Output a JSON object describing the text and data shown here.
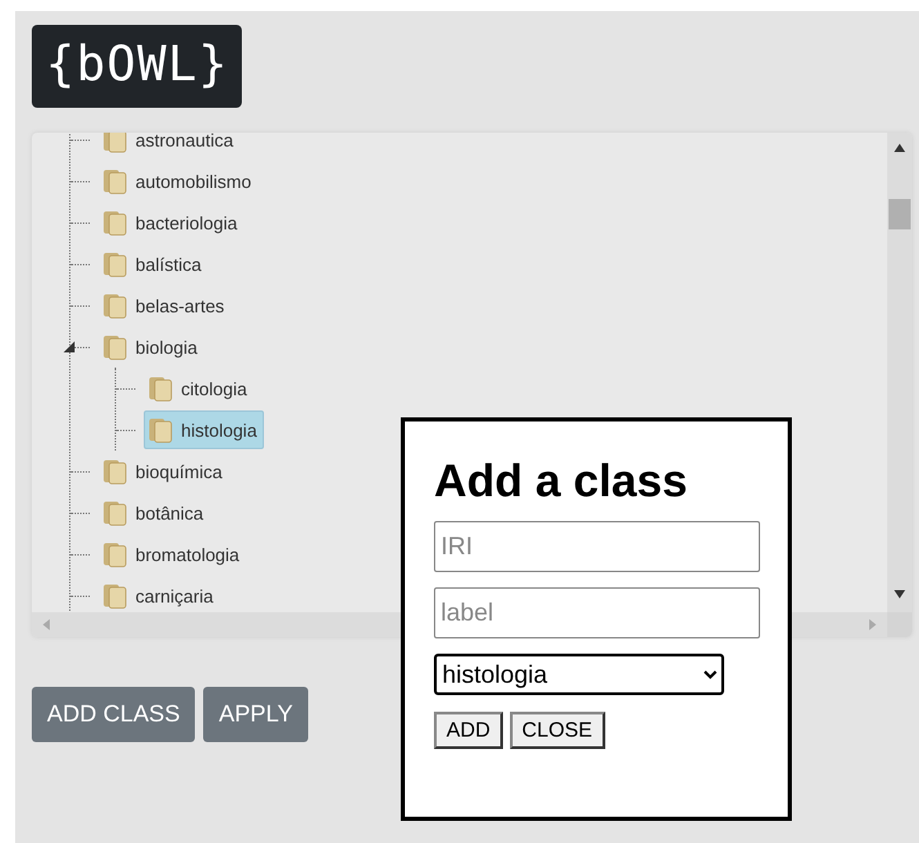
{
  "logo": "{bOWL}",
  "tree": [
    {
      "label": "astronautica",
      "selected": false
    },
    {
      "label": "automobilismo",
      "selected": false
    },
    {
      "label": "bacteriologia",
      "selected": false
    },
    {
      "label": "balística",
      "selected": false
    },
    {
      "label": "belas-artes",
      "selected": false
    },
    {
      "label": "biologia",
      "selected": false,
      "expanded": true,
      "children": [
        {
          "label": "citologia",
          "selected": false
        },
        {
          "label": "histologia",
          "selected": true
        }
      ]
    },
    {
      "label": "bioquímica",
      "selected": false
    },
    {
      "label": "botânica",
      "selected": false
    },
    {
      "label": "bromatologia",
      "selected": false
    },
    {
      "label": "carniçaria",
      "selected": false
    }
  ],
  "buttons": [
    "ADD CLASS",
    "APPLY"
  ],
  "dialog": {
    "title": "Add a class",
    "fields": [
      {
        "placeholder": "IRI"
      },
      {
        "placeholder": "label"
      }
    ],
    "parent_select": "histologia",
    "buttons": [
      "ADD",
      "CLOSE"
    ]
  }
}
